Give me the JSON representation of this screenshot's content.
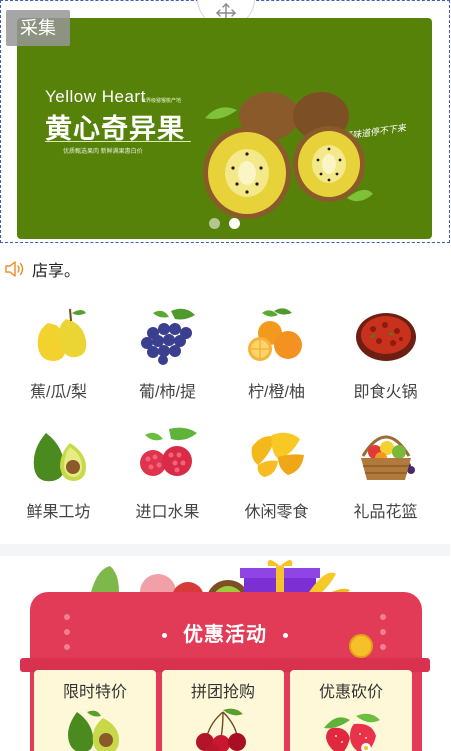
{
  "toolbar": {
    "collect_label": "采集"
  },
  "banner": {
    "brand_en": "Yellow Heart",
    "brand_tag": "世界级猕猴桃产地",
    "brand_cn": "黄心奇异果",
    "brand_sub": "优质甄选果肉 新鲜满果惠白价",
    "slogan": "好味道停不下来",
    "active_slide": 2,
    "slide_count": 2,
    "bg_color": "#57820a"
  },
  "notice": {
    "icon": "speaker-icon",
    "text": "店享。"
  },
  "categories": [
    {
      "label": "蕉/瓜/梨",
      "icon": "pear-icon"
    },
    {
      "label": "葡/柿/提",
      "icon": "grape-icon"
    },
    {
      "label": "柠/橙/柚",
      "icon": "orange-icon"
    },
    {
      "label": "即食火锅",
      "icon": "hotpot-icon"
    },
    {
      "label": "鲜果工坊",
      "icon": "avocado-icon"
    },
    {
      "label": "进口水果",
      "icon": "raspberry-icon"
    },
    {
      "label": "休闲零食",
      "icon": "mango-icon"
    },
    {
      "label": "礼品花篮",
      "icon": "fruit-basket-icon"
    }
  ],
  "promo": {
    "title": "优惠活动",
    "accent": "#e23b57",
    "deals": [
      {
        "label": "限时特价",
        "icon": "avocado-icon"
      },
      {
        "label": "拼团抢购",
        "icon": "cherry-icon"
      },
      {
        "label": "优惠砍价",
        "icon": "strawberry-icon"
      }
    ]
  }
}
